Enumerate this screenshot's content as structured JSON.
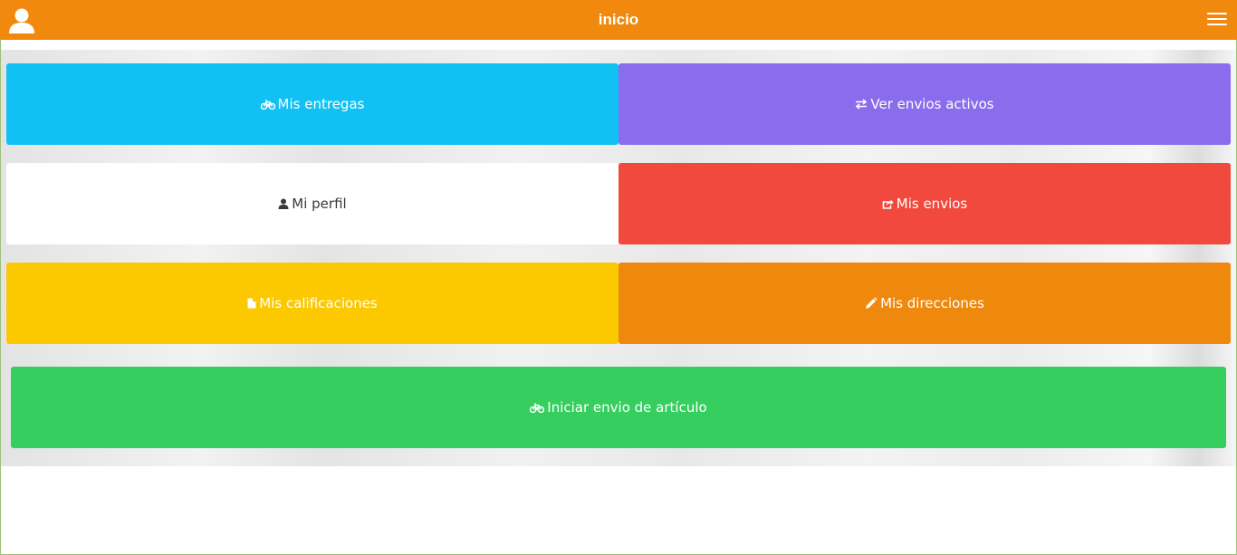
{
  "header": {
    "title": "inicio",
    "icons": {
      "user": "user-icon",
      "menu": "hamburger-menu-icon"
    },
    "color": "#f0890d"
  },
  "tiles": [
    {
      "label": "Mis entregas",
      "icon": "bicycle-icon",
      "color": "#12c1f3"
    },
    {
      "label": "Ver envios activos",
      "icon": "exchange-arrows-icon",
      "color": "#8a6cec"
    },
    {
      "label": "Mi perfil",
      "icon": "user-icon",
      "color": "#ffffff"
    },
    {
      "label": "Mis envios",
      "icon": "share-icon",
      "color": "#f1493d"
    },
    {
      "label": "Mis calificaciones",
      "icon": "file-icon",
      "color": "#fcc900"
    },
    {
      "label": "Mis direcciones",
      "icon": "pencil-icon",
      "color": "#ee890d"
    },
    {
      "label": "Iniciar envio de artículo",
      "icon": "bicycle-icon",
      "color": "#35ce5f"
    }
  ]
}
